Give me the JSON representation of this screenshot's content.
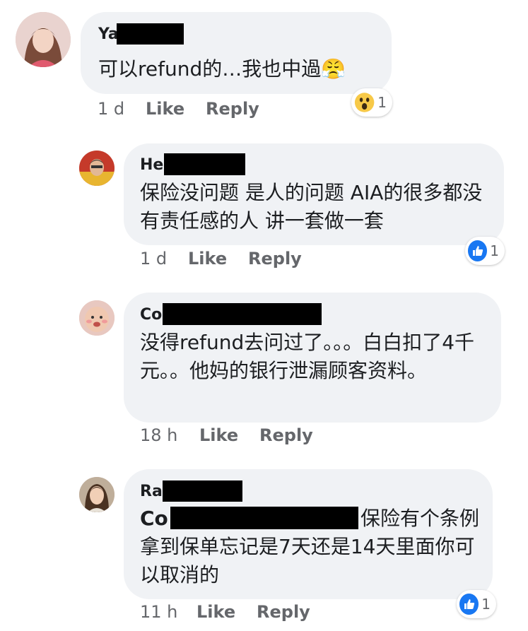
{
  "comments": [
    {
      "name_visible": "Ya",
      "text": "可以refund的…我也中過😤",
      "time": "1 d",
      "like_label": "Like",
      "reply_label": "Reply",
      "reaction": {
        "icon": "wow-emoji-icon",
        "count": "1"
      }
    },
    {
      "name_visible": "He",
      "text": "保险没问题 是人的问题 AIA的很多都没有责任感的人 讲一套做一套",
      "time": "1 d",
      "like_label": "Like",
      "reply_label": "Reply",
      "reaction": {
        "icon": "thumbs-up-icon",
        "count": "1"
      }
    },
    {
      "name_visible": "Co",
      "text": "没得refund去问过了。。。白白扣了4千元。。他妈的银行泄漏顾客资料。",
      "time": "18 h",
      "like_label": "Like",
      "reply_label": "Reply"
    },
    {
      "name_visible": "Ra",
      "mention_visible": "Co",
      "text": "保险有个条例拿到保单忘记是7天还是14天里面你可以取消的",
      "time": "11 h",
      "like_label": "Like",
      "reply_label": "Reply",
      "reaction": {
        "icon": "thumbs-up-icon",
        "count": "1"
      }
    }
  ],
  "colors": {
    "bubble": "#f0f2f5",
    "meta_text": "#65676b",
    "like_blue": "#1877f2"
  }
}
